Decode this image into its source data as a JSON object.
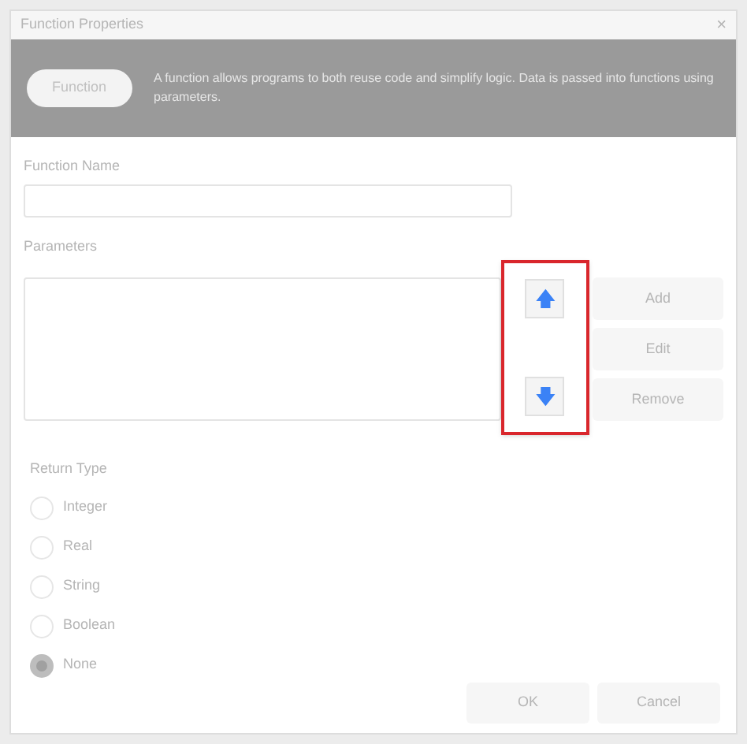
{
  "window": {
    "title": "Function Properties",
    "close": "×"
  },
  "header": {
    "badge": "Function",
    "description": "A function allows programs to both reuse code and simplify logic. Data is passed into functions using parameters."
  },
  "function_name": {
    "label": "Function Name"
  },
  "parameters": {
    "label": "Parameters",
    "move_up": "🡅",
    "move_down": "🡇",
    "highlighted": true,
    "buttons": [
      "Add",
      "Edit",
      "Remove"
    ]
  },
  "return_type": {
    "label": "Return Type",
    "options": [
      {
        "label": "Integer",
        "selected": false
      },
      {
        "label": "Real",
        "selected": false
      },
      {
        "label": "String",
        "selected": false
      },
      {
        "label": "Boolean",
        "selected": false
      },
      {
        "label": "None",
        "selected": true
      }
    ]
  },
  "buttons": [
    "OK",
    "Cancel"
  ]
}
